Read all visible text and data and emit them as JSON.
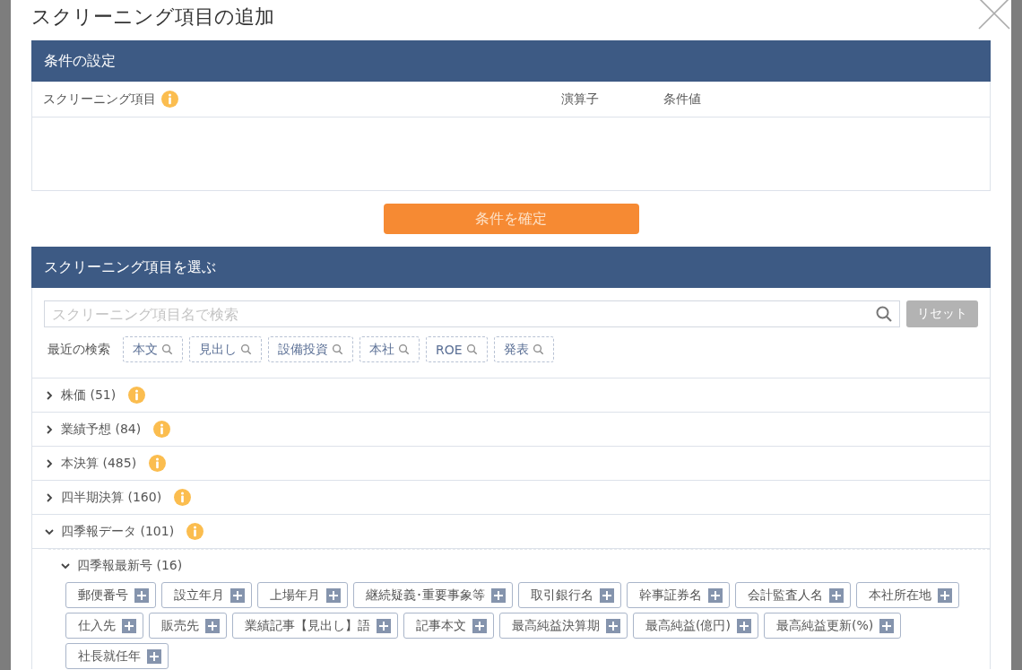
{
  "dialog": {
    "title": "スクリーニング項目の追加"
  },
  "condition_panel": {
    "header": "条件の設定",
    "columns": [
      "スクリーニング項目",
      "演算子",
      "条件値"
    ]
  },
  "confirm_button": "条件を確定",
  "select_panel": {
    "header": "スクリーニング項目を選ぶ",
    "search": {
      "placeholder": "スクリーニング項目名で検索"
    },
    "reset_button": "リセット",
    "recent_label": "最近の検索",
    "recent": [
      "本文",
      "見出し",
      "設備投資",
      "本社",
      "ROE",
      "発表"
    ],
    "categories": [
      {
        "label": "株価 (51)",
        "expanded": false
      },
      {
        "label": "業績予想 (84)",
        "expanded": false
      },
      {
        "label": "本決算 (485)",
        "expanded": false
      },
      {
        "label": "四半期決算 (160)",
        "expanded": false
      },
      {
        "label": "四季報データ (101)",
        "expanded": true,
        "children": [
          {
            "label": "四季報最新号 (16)",
            "expanded": true,
            "items": [
              "郵便番号",
              "設立年月",
              "上場年月",
              "継続疑義･重要事象等",
              "取引銀行名",
              "幹事証券名",
              "会計監査人名",
              "本社所在地",
              "仕入先",
              "販売先",
              "業績記事【見出し】語",
              "記事本文",
              "最高純益決算期",
              "最高純益(億円)",
              "最高純益更新(%)",
              "社長就任年"
            ]
          }
        ]
      }
    ]
  }
}
